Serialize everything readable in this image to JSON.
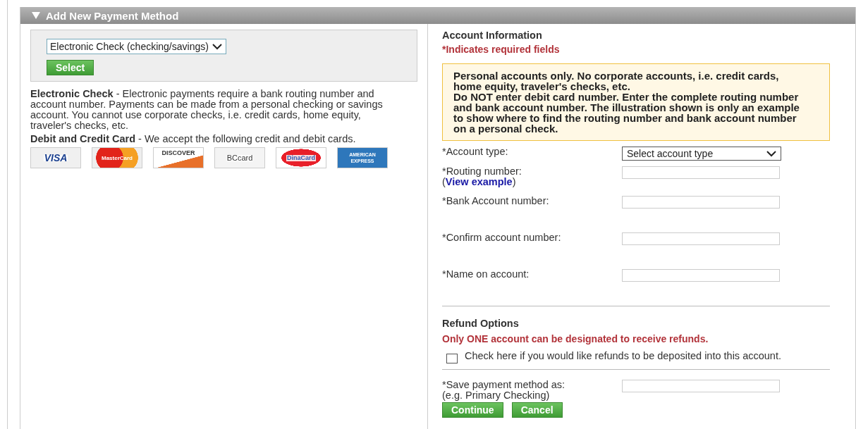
{
  "panel": {
    "title": "Add New Payment Method",
    "expanded": true
  },
  "method_select": {
    "value": "Electronic Check (checking/savings)"
  },
  "select_button": "Select",
  "descriptions": [
    {
      "text": "**Electronic Check** - Electronic payments require a bank routing number and account number. Payments can be made from a personal checking or savings account. You cannot use corporate checks, i.e. credit cards, home equity, traveler's checks, etc."
    },
    {
      "text": "**Debit and Credit Card** - We accept the following credit and debit cards."
    }
  ],
  "cards": [
    {
      "kind": "visa",
      "label": "VISA"
    },
    {
      "kind": "mastercard",
      "label": "MasterCard"
    },
    {
      "kind": "discover",
      "label": "DISCOVER"
    },
    {
      "kind": "bccard",
      "label": "BCcard"
    },
    {
      "kind": "dinacard",
      "label": "DinaCard"
    },
    {
      "kind": "amex",
      "label": "AMERICAN EXPRESS"
    }
  ],
  "account_info": {
    "title": "Account Information",
    "required_note": "*Indicates required fields",
    "notice": [
      "Personal accounts only. No corporate accounts, i.e. credit cards, home equity, traveler's checks, etc.",
      "Do NOT enter debit card number. Enter the complete routing number and bank account number. The illustration shown is only an example to show where to find the routing number and bank account number on a personal check."
    ],
    "fields": [
      {
        "kind": "select",
        "label": "*Account type:",
        "value": "Select account type"
      },
      {
        "kind": "input",
        "label": "*Routing number:",
        "link_open": "(",
        "link": "View example",
        "link_close": ")"
      },
      {
        "kind": "input",
        "label": "*Bank Account number:"
      },
      {
        "kind": "input",
        "label": "*Confirm account number:"
      },
      {
        "kind": "input",
        "label": "*Name on account:"
      }
    ]
  },
  "refund": {
    "title": "Refund Options",
    "warning": "Only ONE account can be designated to receive refunds.",
    "checkbox": {
      "label": "Check here if you would like refunds to be deposited into this account.",
      "checked": false
    }
  },
  "save_as": {
    "label": "*Save payment method as:",
    "hint": "(e.g. Primary Checking)"
  },
  "buttons": [
    "Continue",
    "Cancel"
  ]
}
